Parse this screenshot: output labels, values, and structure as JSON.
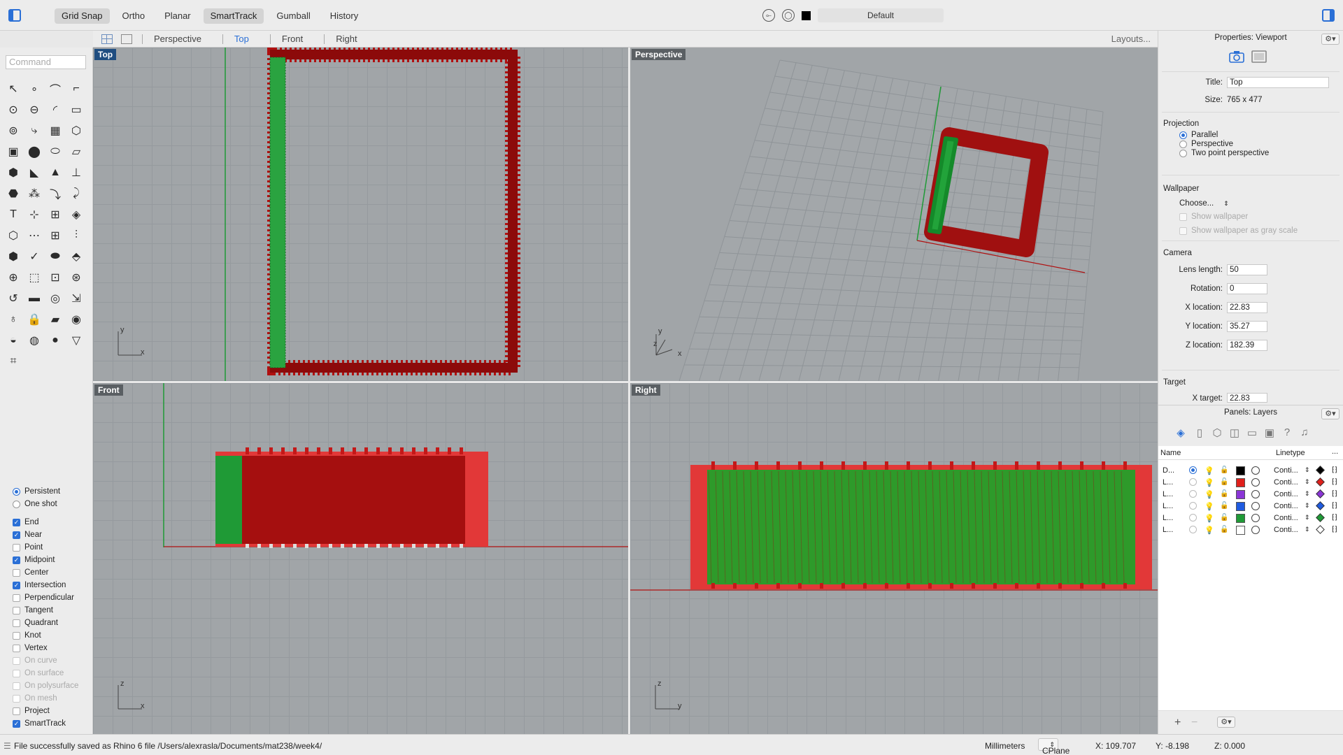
{
  "toolbar": {
    "modes": [
      {
        "label": "Grid Snap",
        "on": true
      },
      {
        "label": "Ortho",
        "on": false
      },
      {
        "label": "Planar",
        "on": false
      },
      {
        "label": "SmartTrack",
        "on": true
      },
      {
        "label": "Gumball",
        "on": false
      },
      {
        "label": "History",
        "on": false
      }
    ],
    "current_layer": "Default"
  },
  "viewport_tabs": {
    "tabs": [
      "Perspective",
      "Top",
      "Front",
      "Right"
    ],
    "active": "Top",
    "layouts_label": "Layouts..."
  },
  "command": {
    "placeholder": "Command"
  },
  "tools": [
    "↖",
    "∘",
    "⌒",
    "⌐",
    "⊙",
    "⊖",
    "◜",
    "▭",
    "⊚",
    "⤷",
    "▦",
    "⬡",
    "▣",
    "⬤",
    "⬭",
    "▱",
    "⬢",
    "◣",
    "▲",
    "⊥",
    "⬣",
    "⁂",
    "⤵",
    "⤸",
    "T",
    "⊹",
    "⊞",
    "◈",
    "⬡",
    "⋯",
    "⊞",
    "⫶",
    "⬢",
    "✓",
    "⬬",
    "⬘",
    "⊕",
    "⬚",
    "⊡",
    "⊛",
    "↺",
    "▬",
    "◎",
    "⇲",
    "♁",
    "🔒",
    "▰",
    "◉",
    "◒",
    "◍",
    "●",
    "▽",
    "⌗"
  ],
  "osnap": {
    "modes": [
      {
        "label": "Persistent",
        "on": true
      },
      {
        "label": "One shot",
        "on": false
      }
    ],
    "items": [
      {
        "label": "End",
        "checked": true,
        "enabled": true
      },
      {
        "label": "Near",
        "checked": true,
        "enabled": true
      },
      {
        "label": "Point",
        "checked": false,
        "enabled": true
      },
      {
        "label": "Midpoint",
        "checked": true,
        "enabled": true
      },
      {
        "label": "Center",
        "checked": false,
        "enabled": true
      },
      {
        "label": "Intersection",
        "checked": true,
        "enabled": true
      },
      {
        "label": "Perpendicular",
        "checked": false,
        "enabled": true
      },
      {
        "label": "Tangent",
        "checked": false,
        "enabled": true
      },
      {
        "label": "Quadrant",
        "checked": false,
        "enabled": true
      },
      {
        "label": "Knot",
        "checked": false,
        "enabled": true
      },
      {
        "label": "Vertex",
        "checked": false,
        "enabled": true
      },
      {
        "label": "On curve",
        "checked": false,
        "enabled": false
      },
      {
        "label": "On surface",
        "checked": false,
        "enabled": false
      },
      {
        "label": "On polysurface",
        "checked": false,
        "enabled": false
      },
      {
        "label": "On mesh",
        "checked": false,
        "enabled": false
      },
      {
        "label": "Project",
        "checked": false,
        "enabled": true
      },
      {
        "label": "SmartTrack",
        "checked": true,
        "enabled": true
      }
    ]
  },
  "viewports": {
    "top": {
      "label": "Top",
      "axes": [
        "y",
        "x"
      ]
    },
    "perspective": {
      "label": "Perspective",
      "axes": [
        "y",
        "z",
        "x"
      ]
    },
    "front": {
      "label": "Front",
      "axes": [
        "z",
        "x"
      ]
    },
    "right": {
      "label": "Right",
      "axes": [
        "z",
        "y"
      ]
    }
  },
  "properties": {
    "title": "Properties: Viewport",
    "title_label": "Title:",
    "title_value": "Top",
    "size_label": "Size:",
    "size_value": "765 x 477",
    "projection_label": "Projection",
    "projection_options": [
      {
        "label": "Parallel",
        "on": true
      },
      {
        "label": "Perspective",
        "on": false
      },
      {
        "label": "Two point perspective",
        "on": false
      }
    ],
    "wallpaper_label": "Wallpaper",
    "wallpaper_choose": "Choose...",
    "show_wallpaper": "Show wallpaper",
    "show_wallpaper_gray": "Show wallpaper as gray scale",
    "camera_label": "Camera",
    "camera_fields": [
      {
        "label": "Lens length:",
        "value": "50"
      },
      {
        "label": "Rotation:",
        "value": "0"
      },
      {
        "label": "X location:",
        "value": "22.83"
      },
      {
        "label": "Y location:",
        "value": "35.27"
      },
      {
        "label": "Z location:",
        "value": "182.39"
      }
    ],
    "target_label": "Target",
    "x_target_label": "X target:",
    "x_target_value": "22.83"
  },
  "layers": {
    "title": "Panels: Layers",
    "col_name": "Name",
    "col_linetype": "Linetype",
    "col_more": "...",
    "rows": [
      {
        "name": "D...",
        "current": true,
        "color": "#000000",
        "linetype": "Conti..."
      },
      {
        "name": "L...",
        "current": false,
        "color": "#e0201b",
        "linetype": "Conti..."
      },
      {
        "name": "L...",
        "current": false,
        "color": "#8a35d6",
        "linetype": "Conti..."
      },
      {
        "name": "L...",
        "current": false,
        "color": "#1f5be0",
        "linetype": "Conti..."
      },
      {
        "name": "L...",
        "current": false,
        "color": "#1f9a36",
        "linetype": "Conti..."
      },
      {
        "name": "L...",
        "current": false,
        "color": "#ffffff",
        "linetype": "Conti..."
      }
    ]
  },
  "status": {
    "message": "File successfully saved as Rhino 6 file /Users/alexrasla/Documents/mat238/week4/",
    "units": "Millimeters",
    "cplane": "CPlane",
    "x": "X: 109.707",
    "y": "Y: -8.198",
    "z": "Z: 0.000"
  }
}
